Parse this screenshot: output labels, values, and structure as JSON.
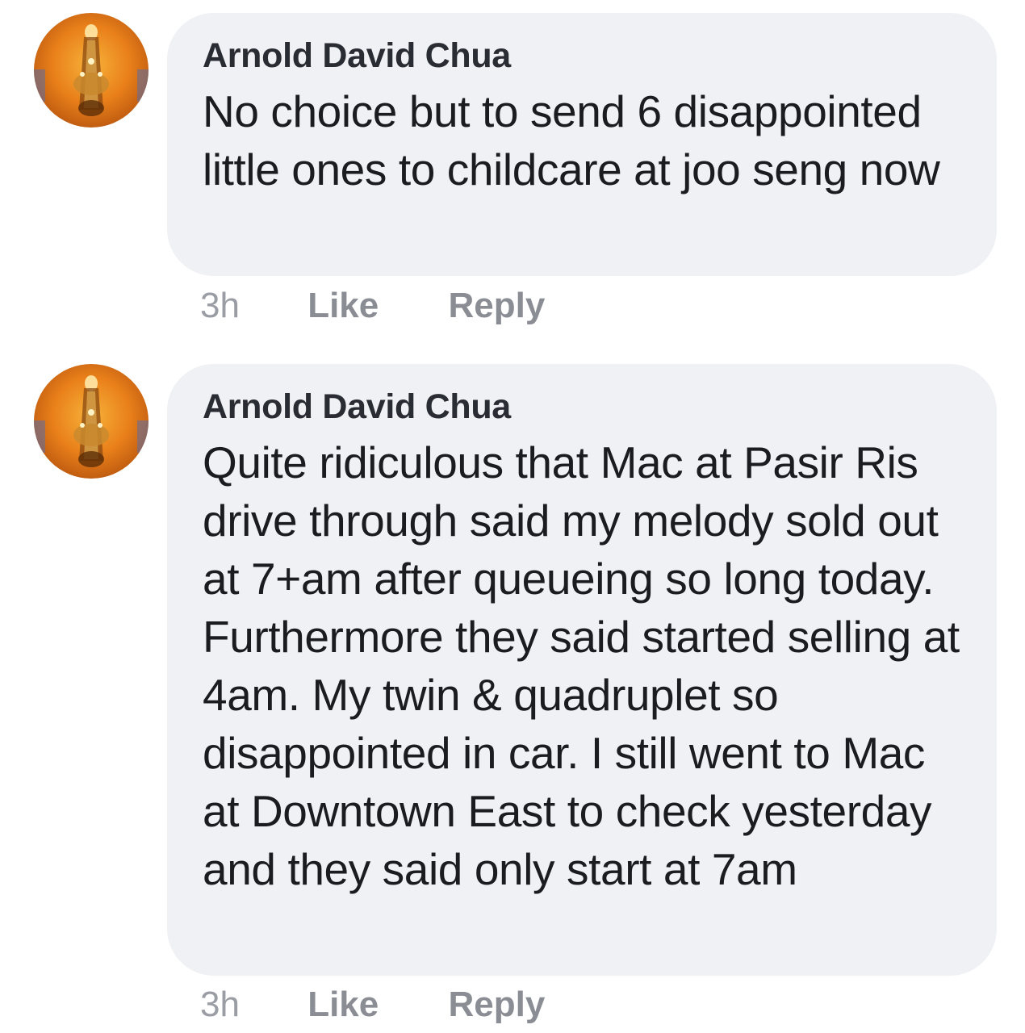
{
  "comments": [
    {
      "author": "Arnold David Chua",
      "text": "No choice but to send 6 disappointed little ones to childcare at joo seng now",
      "time": "3h",
      "like_label": "Like",
      "reply_label": "Reply"
    },
    {
      "author": "Arnold David Chua",
      "text": "Quite ridiculous that Mac at Pasir Ris drive through said my melody sold out at 7+am after queueing so long today. Furthermore they said started selling at 4am. My twin & quadruplet so disappointed in car. I still went to Mac at Downtown East to check yesterday and they said only start at 7am",
      "time": "3h",
      "like_label": "Like",
      "reply_label": "Reply"
    }
  ],
  "colors": {
    "bubble": "#f0f1f4",
    "author": "#2a2c33",
    "meta": "#8a8d94",
    "avatar_accent": "#e9801a"
  },
  "icons": [
    "avatar-chandelier-icon"
  ]
}
